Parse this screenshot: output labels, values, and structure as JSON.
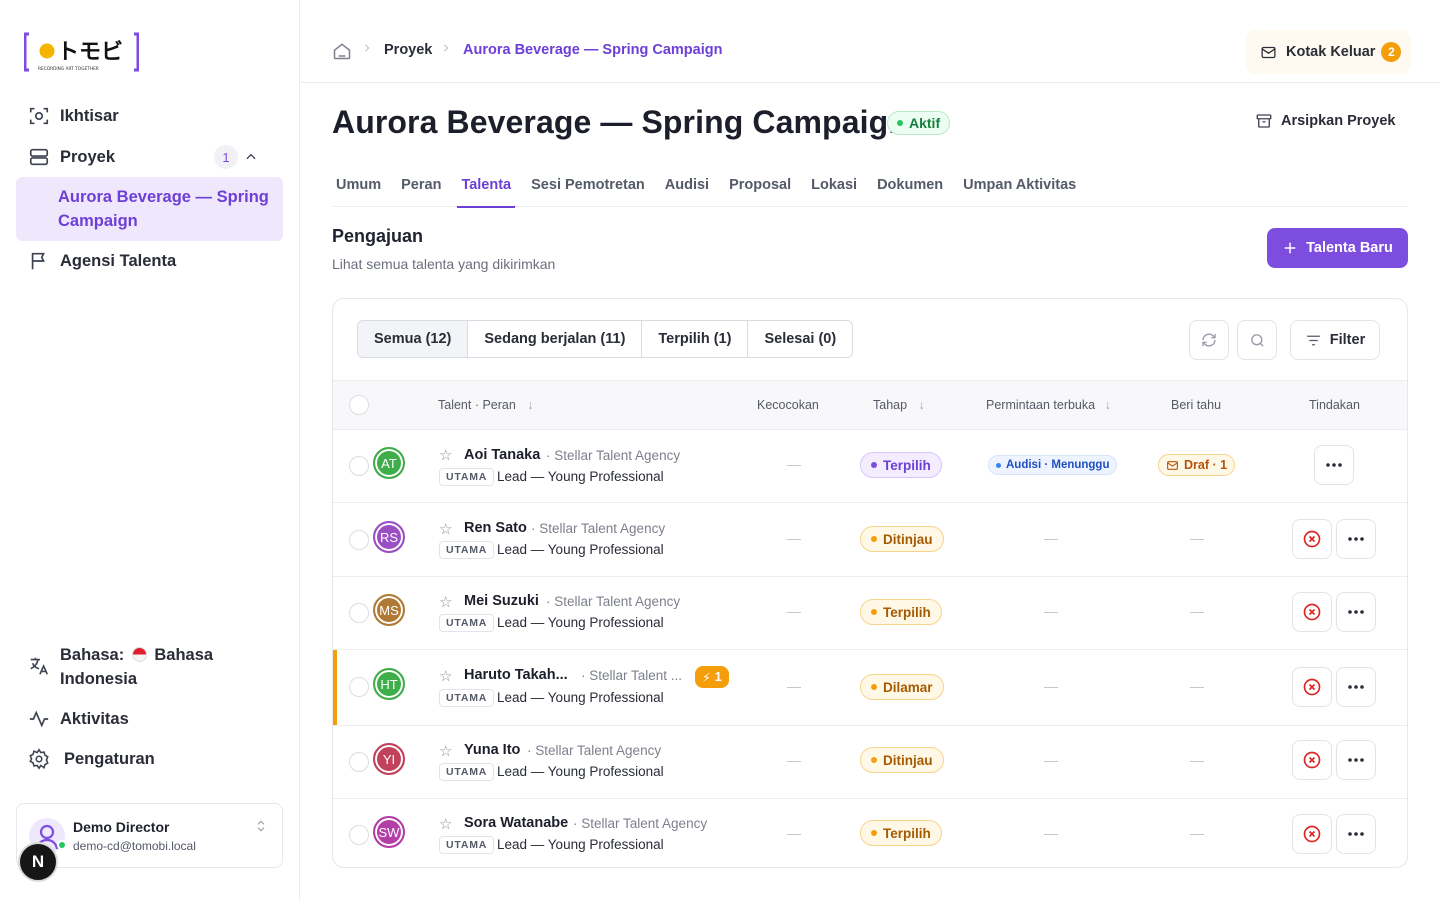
{
  "brand": {
    "logo_text": "トモビ",
    "logo_tagline": "RECORDING ART TOGETHER",
    "accent": "#7c4ddf"
  },
  "sidebar": {
    "items": [
      {
        "label": "Ikhtisar",
        "icon": "overview-icon"
      },
      {
        "label": "Proyek",
        "icon": "projects-icon",
        "count": "1"
      },
      {
        "label": "Agensi Talenta",
        "icon": "flag-icon"
      }
    ],
    "active_project": "Aurora Beverage — Spring Campaign",
    "language_label": "Bahasa:",
    "language_value": "Bahasa Indonesia",
    "activity": "Aktivitas",
    "settings": "Pengaturan",
    "user": {
      "name": "Demo Director",
      "email": "demo-cd@tomobi.local"
    },
    "next_badge": "N"
  },
  "header": {
    "breadcrumb": [
      "Proyek",
      "Aurora Beverage — Spring Campaign"
    ],
    "outbox_label": "Kotak Keluar",
    "outbox_count": "2"
  },
  "project": {
    "title": "Aurora Beverage — Spring Campaign",
    "status": "Aktif",
    "archive_label": "Arsipkan Proyek"
  },
  "tabs": [
    "Umum",
    "Peran",
    "Talenta",
    "Sesi Pemotretan",
    "Audisi",
    "Proposal",
    "Lokasi",
    "Dokumen",
    "Umpan Aktivitas"
  ],
  "active_tab": "Talenta",
  "submissions": {
    "title": "Pengajuan",
    "subtitle": "Lihat semua talenta yang dikirimkan",
    "new_button": "Talenta Baru",
    "filters": [
      "Semua (12)",
      "Sedang berjalan (11)",
      "Terpilih (1)",
      "Selesai (0)"
    ],
    "filter_button": "Filter",
    "columns": [
      "Talent · Peran",
      "Kecocokan",
      "Tahap",
      "Permintaan terbuka",
      "Beri tahu",
      "Tindakan"
    ],
    "rows": [
      {
        "initials": "AT",
        "name": "Aoi Tanaka",
        "agency": "· Stellar Talent Agency",
        "tag": "UTAMA",
        "role": "Lead — Young Professional",
        "match": "—",
        "stage": "Terpilih",
        "stage_color": "purple",
        "request": "Audisi · Menunggu",
        "notify": "Draf · 1",
        "avatar_color": "#3fae4a"
      },
      {
        "initials": "RS",
        "name": "Ren Sato",
        "agency": "· Stellar Talent Agency",
        "tag": "UTAMA",
        "role": "Lead — Young Professional",
        "match": "—",
        "stage": "Ditinjau",
        "stage_color": "amber",
        "request": "—",
        "notify": "—",
        "avatar_color": "#9b4fc4"
      },
      {
        "initials": "MS",
        "name": "Mei Suzuki",
        "agency": "· Stellar Talent Agency",
        "tag": "UTAMA",
        "role": "Lead — Young Professional",
        "match": "—",
        "stage": "Terpilih",
        "stage_color": "amber",
        "request": "—",
        "notify": "—",
        "avatar_color": "#b07a35"
      },
      {
        "initials": "HT",
        "name": "Haruto Takah...",
        "agency": "· Stellar Talent ...",
        "tag": "UTAMA",
        "role": "Lead — Young Professional",
        "match": "—",
        "stage": "Dilamar",
        "stage_color": "amber",
        "request": "—",
        "notify": "—",
        "avatar_color": "#3fae4a",
        "warning": "1"
      },
      {
        "initials": "YI",
        "name": "Yuna Ito",
        "agency": "· Stellar Talent Agency",
        "tag": "UTAMA",
        "role": "Lead — Young Professional",
        "match": "—",
        "stage": "Ditinjau",
        "stage_color": "amber",
        "request": "—",
        "notify": "—",
        "avatar_color": "#c2415b"
      },
      {
        "initials": "SW",
        "name": "Sora Watanabe",
        "agency": "· Stellar Talent Agency",
        "tag": "UTAMA",
        "role": "Lead — Young Professional",
        "match": "—",
        "stage": "Terpilih",
        "stage_color": "amber",
        "request": "—",
        "notify": "—",
        "avatar_color": "#b23ea6"
      }
    ]
  }
}
